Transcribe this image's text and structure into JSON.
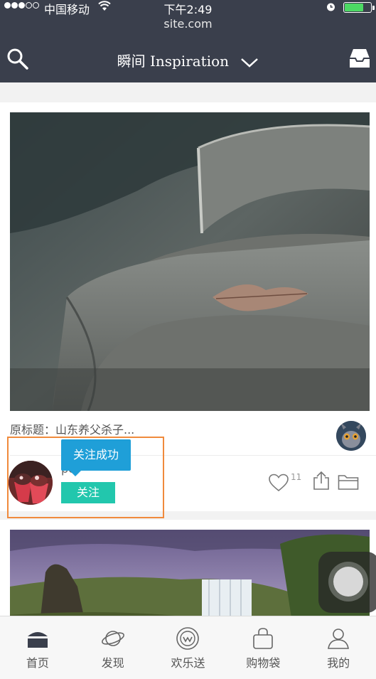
{
  "status_bar": {
    "carrier": "中国移动",
    "time": "下午2:49",
    "battery_level": 0.75,
    "url": "site.com"
  },
  "nav": {
    "title": "瞬间 Inspiration",
    "left_icon": "search-icon",
    "right_icon": "inbox-icon"
  },
  "post": {
    "caption": "原标题：山东养父杀子...",
    "username": "pc",
    "follow_label": "关注",
    "toast": "关注成功",
    "like_count": "11",
    "colors": {
      "follow": "#22c7ad",
      "toast": "#1f9fd8",
      "highlight": "#f08a3c"
    }
  },
  "tabbar": {
    "items": [
      {
        "label": "首页",
        "icon": "home-icon"
      },
      {
        "label": "发现",
        "icon": "planet-icon"
      },
      {
        "label": "欢乐送",
        "icon": "smile-badge-icon"
      },
      {
        "label": "购物袋",
        "icon": "shopping-bag-icon"
      },
      {
        "label": "我的",
        "icon": "profile-icon"
      }
    ]
  }
}
